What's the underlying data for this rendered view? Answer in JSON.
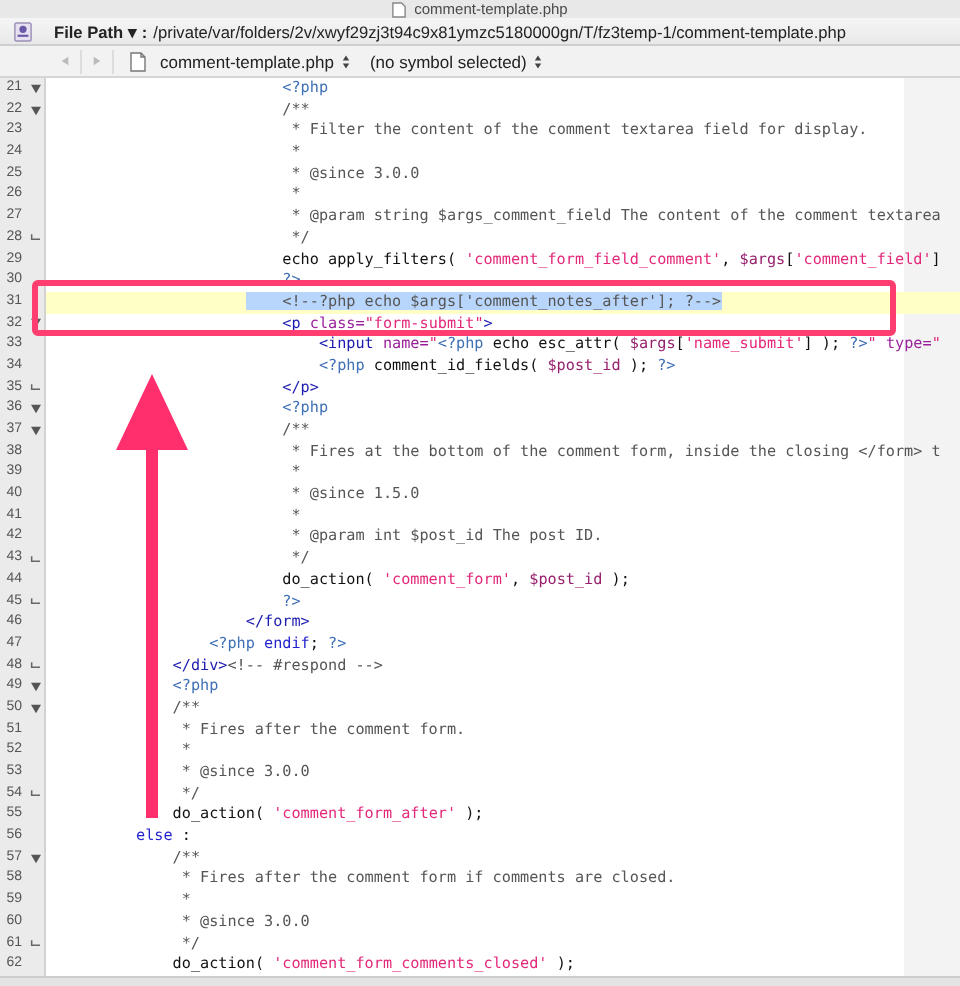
{
  "window": {
    "title": "comment-template.php"
  },
  "path_bar": {
    "label": "File Path",
    "caret": "▾",
    "separator": ":",
    "path": "/private/var/folders/2v/xwyf29zj3t94c9x81ymzc5180000gn/T/fz3temp-1/comment-template.php"
  },
  "nav_bar": {
    "back": {
      "disabled": true
    },
    "forward": {
      "disabled": true
    },
    "file_menu": "comment-template.php",
    "symbol_menu": "(no symbol selected)"
  },
  "lines": [
    {
      "number": "21",
      "kind": "fold_start",
      "current": false,
      "selected": false,
      "tokens": [
        {
          "kind": "php",
          "text": "                <?php"
        }
      ]
    },
    {
      "number": "22",
      "kind": "fold_start",
      "current": false,
      "selected": false,
      "tokens": [
        {
          "kind": "comment",
          "text": "                /**"
        }
      ]
    },
    {
      "number": "23",
      "kind": "plain",
      "current": false,
      "selected": false,
      "tokens": [
        {
          "kind": "comment",
          "text": "                 * Filter the content of the comment textarea field for display."
        }
      ]
    },
    {
      "number": "24",
      "kind": "plain",
      "current": false,
      "selected": false,
      "tokens": [
        {
          "kind": "comment",
          "text": "                 *"
        }
      ]
    },
    {
      "number": "25",
      "kind": "plain",
      "current": false,
      "selected": false,
      "tokens": [
        {
          "kind": "comment",
          "text": "                 * @since 3.0.0"
        }
      ]
    },
    {
      "number": "26",
      "kind": "plain",
      "current": false,
      "selected": false,
      "tokens": [
        {
          "kind": "comment",
          "text": "                 *"
        }
      ]
    },
    {
      "number": "27",
      "kind": "plain",
      "current": false,
      "selected": false,
      "tokens": [
        {
          "kind": "comment",
          "text": "                 * @param string $args_comment_field The content of the comment textarea"
        }
      ]
    },
    {
      "number": "28",
      "kind": "fold_end",
      "current": false,
      "selected": false,
      "tokens": [
        {
          "kind": "comment",
          "text": "                 */"
        }
      ]
    },
    {
      "number": "29",
      "kind": "plain",
      "current": false,
      "selected": false,
      "tokens": [
        {
          "kind": "plain",
          "text": "                echo apply_filters( "
        },
        {
          "kind": "string",
          "text": "'comment_form_field_comment'"
        },
        {
          "kind": "plain",
          "text": ", "
        },
        {
          "kind": "variable",
          "text": "$args"
        },
        {
          "kind": "plain",
          "text": "["
        },
        {
          "kind": "string",
          "text": "'comment_field'"
        },
        {
          "kind": "plain",
          "text": "]"
        }
      ]
    },
    {
      "number": "30",
      "kind": "plain",
      "current": false,
      "selected": false,
      "tokens": [
        {
          "kind": "php",
          "text": "                ?>"
        }
      ]
    },
    {
      "number": "31",
      "kind": "plain",
      "current": true,
      "selected": true,
      "tokens": [
        {
          "kind": "comment",
          "text": "                <!--?php echo $args['comment_notes_after']; ?-->"
        }
      ]
    },
    {
      "number": "32",
      "kind": "fold_start",
      "current": false,
      "selected": false,
      "tokens": [
        {
          "kind": "tag",
          "text": "                <p"
        },
        {
          "kind": "attr",
          "text": " class="
        },
        {
          "kind": "string",
          "text": "\"form-submit\""
        },
        {
          "kind": "tag",
          "text": ">"
        }
      ]
    },
    {
      "number": "33",
      "kind": "plain",
      "current": false,
      "selected": false,
      "tokens": [
        {
          "kind": "tag",
          "text": "                    <input"
        },
        {
          "kind": "attr",
          "text": " name="
        },
        {
          "kind": "string",
          "text": "\""
        },
        {
          "kind": "php",
          "text": "<?php"
        },
        {
          "kind": "plain",
          "text": " echo esc_attr( "
        },
        {
          "kind": "variable",
          "text": "$args"
        },
        {
          "kind": "plain",
          "text": "["
        },
        {
          "kind": "string",
          "text": "'name_submit'"
        },
        {
          "kind": "plain",
          "text": "] ); "
        },
        {
          "kind": "php",
          "text": "?>"
        },
        {
          "kind": "string",
          "text": "\""
        },
        {
          "kind": "attr",
          "text": " type="
        },
        {
          "kind": "string",
          "text": "\""
        }
      ]
    },
    {
      "number": "34",
      "kind": "plain",
      "current": false,
      "selected": false,
      "tokens": [
        {
          "kind": "php",
          "text": "                    <?php"
        },
        {
          "kind": "plain",
          "text": " comment_id_fields( "
        },
        {
          "kind": "variable",
          "text": "$post_id"
        },
        {
          "kind": "plain",
          "text": " ); "
        },
        {
          "kind": "php",
          "text": "?>"
        }
      ]
    },
    {
      "number": "35",
      "kind": "fold_end",
      "current": false,
      "selected": false,
      "tokens": [
        {
          "kind": "tag",
          "text": "                </p>"
        }
      ]
    },
    {
      "number": "36",
      "kind": "fold_start",
      "current": false,
      "selected": false,
      "tokens": [
        {
          "kind": "php",
          "text": "                <?php"
        }
      ]
    },
    {
      "number": "37",
      "kind": "fold_start",
      "current": false,
      "selected": false,
      "tokens": [
        {
          "kind": "comment",
          "text": "                /**"
        }
      ]
    },
    {
      "number": "38",
      "kind": "plain",
      "current": false,
      "selected": false,
      "tokens": [
        {
          "kind": "comment",
          "text": "                 * Fires at the bottom of the comment form, inside the closing </form> t"
        }
      ]
    },
    {
      "number": "39",
      "kind": "plain",
      "current": false,
      "selected": false,
      "tokens": [
        {
          "kind": "comment",
          "text": "                 *"
        }
      ]
    },
    {
      "number": "40",
      "kind": "plain",
      "current": false,
      "selected": false,
      "tokens": [
        {
          "kind": "comment",
          "text": "                 * @since 1.5.0"
        }
      ]
    },
    {
      "number": "41",
      "kind": "plain",
      "current": false,
      "selected": false,
      "tokens": [
        {
          "kind": "comment",
          "text": "                 *"
        }
      ]
    },
    {
      "number": "42",
      "kind": "plain",
      "current": false,
      "selected": false,
      "tokens": [
        {
          "kind": "comment",
          "text": "                 * @param int $post_id The post ID."
        }
      ]
    },
    {
      "number": "43",
      "kind": "fold_end",
      "current": false,
      "selected": false,
      "tokens": [
        {
          "kind": "comment",
          "text": "                 */"
        }
      ]
    },
    {
      "number": "44",
      "kind": "plain",
      "current": false,
      "selected": false,
      "tokens": [
        {
          "kind": "plain",
          "text": "                do_action( "
        },
        {
          "kind": "string",
          "text": "'comment_form'"
        },
        {
          "kind": "plain",
          "text": ", "
        },
        {
          "kind": "variable",
          "text": "$post_id"
        },
        {
          "kind": "plain",
          "text": " );"
        }
      ]
    },
    {
      "number": "45",
      "kind": "fold_end",
      "current": false,
      "selected": false,
      "tokens": [
        {
          "kind": "php",
          "text": "                ?>"
        }
      ]
    },
    {
      "number": "46",
      "kind": "plain",
      "current": false,
      "selected": false,
      "tokens": [
        {
          "kind": "tag",
          "text": "            </form>"
        }
      ]
    },
    {
      "number": "47",
      "kind": "plain",
      "current": false,
      "selected": false,
      "tokens": [
        {
          "kind": "php",
          "text": "        <?php"
        },
        {
          "kind": "keyword",
          "text": " endif"
        },
        {
          "kind": "plain",
          "text": ";"
        },
        {
          "kind": "php",
          "text": " ?>"
        }
      ]
    },
    {
      "number": "48",
      "kind": "fold_end",
      "current": false,
      "selected": false,
      "tokens": [
        {
          "kind": "tag",
          "text": "    </div>"
        },
        {
          "kind": "comment",
          "text": "<!-- #respond -->"
        }
      ]
    },
    {
      "number": "49",
      "kind": "fold_start",
      "current": false,
      "selected": false,
      "tokens": [
        {
          "kind": "php",
          "text": "    <?php"
        }
      ]
    },
    {
      "number": "50",
      "kind": "fold_start",
      "current": false,
      "selected": false,
      "tokens": [
        {
          "kind": "comment",
          "text": "    /**"
        }
      ]
    },
    {
      "number": "51",
      "kind": "plain",
      "current": false,
      "selected": false,
      "tokens": [
        {
          "kind": "comment",
          "text": "     * Fires after the comment form."
        }
      ]
    },
    {
      "number": "52",
      "kind": "plain",
      "current": false,
      "selected": false,
      "tokens": [
        {
          "kind": "comment",
          "text": "     *"
        }
      ]
    },
    {
      "number": "53",
      "kind": "plain",
      "current": false,
      "selected": false,
      "tokens": [
        {
          "kind": "comment",
          "text": "     * @since 3.0.0"
        }
      ]
    },
    {
      "number": "54",
      "kind": "fold_end",
      "current": false,
      "selected": false,
      "tokens": [
        {
          "kind": "comment",
          "text": "     */"
        }
      ]
    },
    {
      "number": "55",
      "kind": "plain",
      "current": false,
      "selected": false,
      "tokens": [
        {
          "kind": "plain",
          "text": "    do_action( "
        },
        {
          "kind": "string",
          "text": "'comment_form_after'"
        },
        {
          "kind": "plain",
          "text": " );"
        }
      ]
    },
    {
      "number": "56",
      "kind": "plain",
      "current": false,
      "selected": false,
      "tokens": [
        {
          "kind": "keyword",
          "text": "else"
        },
        {
          "kind": "plain",
          "text": " :"
        }
      ]
    },
    {
      "number": "57",
      "kind": "fold_start",
      "current": false,
      "selected": false,
      "tokens": [
        {
          "kind": "comment",
          "text": "    /**"
        }
      ]
    },
    {
      "number": "58",
      "kind": "plain",
      "current": false,
      "selected": false,
      "tokens": [
        {
          "kind": "comment",
          "text": "     * Fires after the comment form if comments are closed."
        }
      ]
    },
    {
      "number": "59",
      "kind": "plain",
      "current": false,
      "selected": false,
      "tokens": [
        {
          "kind": "comment",
          "text": "     *"
        }
      ]
    },
    {
      "number": "60",
      "kind": "plain",
      "current": false,
      "selected": false,
      "tokens": [
        {
          "kind": "comment",
          "text": "     * @since 3.0.0"
        }
      ]
    },
    {
      "number": "61",
      "kind": "fold_end",
      "current": false,
      "selected": false,
      "tokens": [
        {
          "kind": "comment",
          "text": "     */"
        }
      ]
    },
    {
      "number": "62",
      "kind": "plain",
      "current": false,
      "selected": false,
      "tokens": [
        {
          "kind": "plain",
          "text": "    do_action( "
        },
        {
          "kind": "string",
          "text": "'comment_form_comments_closed'"
        },
        {
          "kind": "plain",
          "text": " );"
        }
      ]
    }
  ]
}
